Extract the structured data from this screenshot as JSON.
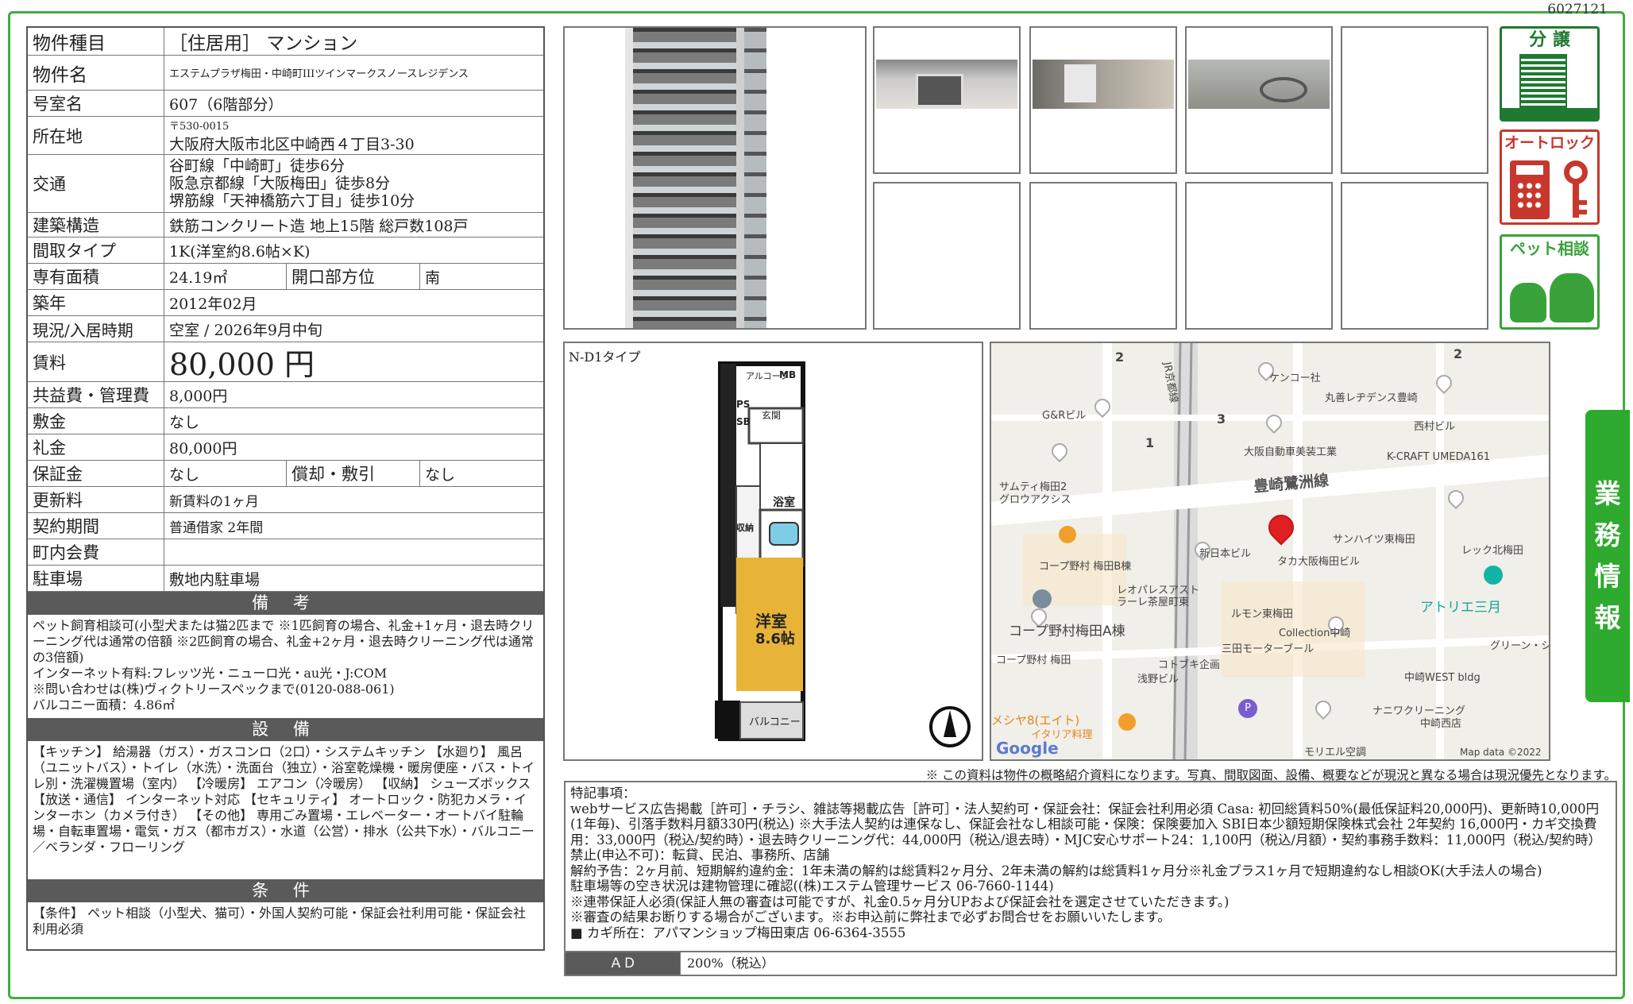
{
  "sheet_id": "6027121",
  "property": {
    "type_label": "物件種目",
    "type_value": "［住居用］ マンション",
    "name_label": "物件名",
    "name_value": "エステムプラザ梅田・中崎町IIIツインマークスノースレジデンス",
    "room_label": "号室名",
    "room_value": "607（6階部分）",
    "address_label": "所在地",
    "postal": "〒530-0015",
    "address": "大阪府大阪市北区中崎西４丁目3-30",
    "transport_label": "交通",
    "transport": [
      "谷町線「中崎町」徒歩6分",
      "阪急京都線「大阪梅田」徒歩8分",
      "堺筋線「天神橋筋六丁目」徒歩10分"
    ],
    "structure_label": "建築構造",
    "structure_value": "鉄筋コンクリート造 地上15階 総戸数108戸",
    "layout_label": "間取タイプ",
    "layout_value": "1K(洋室約8.6帖×K)",
    "area_label": "専有面積",
    "area_value": "24.19㎡",
    "direction_label": "開口部方位",
    "direction_value": "南",
    "built_label": "築年",
    "built_value": "2012年02月",
    "status_label": "現況/入居時期",
    "status_value": "空室 / 2026年9月中旬",
    "rent_label": "賃料",
    "rent_value": "80,000 円",
    "fee_label": "共益費・管理費",
    "fee_value": "8,000円",
    "deposit_label": "敷金",
    "deposit_value": "なし",
    "key_money_label": "礼金",
    "key_money_value": "80,000円",
    "guarantee_label": "保証金",
    "guarantee_value": "なし",
    "amort_label": "償却・敷引",
    "amort_value": "なし",
    "renewal_label": "更新料",
    "renewal_value": "新賃料の1ヶ月",
    "term_label": "契約期間",
    "term_value": "普通借家 2年間",
    "town_label": "町内会費",
    "town_value": "",
    "parking_label": "駐車場",
    "parking_value": "敷地内駐車場"
  },
  "remarks": {
    "title": "備 考",
    "lines": [
      "ペット飼育相談可(小型犬または猫2匹まで ※1匹飼育の場合、礼金+1ヶ月・退去時クリーニング代は通常の倍額 ※2匹飼育の場合、礼金+2ヶ月・退去時クリーニング代は通常の3倍額)",
      "インターネット有料:フレッツ光・ニューロ光・au光・J:COM",
      "※問い合わせは(株)ヴィクトリースペックまで(0120-088-061)",
      "バルコニー面積：4.86㎡"
    ]
  },
  "equipment": {
    "title": "設 備",
    "text": "【キッチン】 給湯器（ガス）・ガスコンロ（2口）・システムキッチン 【水廻り】 風呂（ユニットバス）・トイレ（水洗）・洗面台（独立）・浴室乾燥機・暖房便座・バス・トイレ別・洗濯機置場（室内） 【冷暖房】 エアコン（冷暖房） 【収納】 シューズボックス 【放送・通信】 インターネット対応 【セキュリティ】 オートロック・防犯カメラ・インターホン（カメラ付き） 【その他】 専用ごみ置場・エレベーター・オートバイ駐輪場・自転車置場・電気・ガス（都市ガス）・水道（公営）・排水（公共下水）・バルコニー／ベランダ・フローリング"
  },
  "conditions": {
    "title": "条 件",
    "text": "【条件】 ペット相談（小型犬、猫可）・外国人契約可能・保証会社利用可能・保証会社利用必須"
  },
  "floorplan": {
    "type_label": "N-D1タイプ",
    "rooms": {
      "alcove": "アルコーブ",
      "mb": "MB",
      "ps": "PS",
      "sb": "SB",
      "entrance": "玄関",
      "bath": "浴室",
      "storage": "収納",
      "western_room": "洋室",
      "western_size": "8.6帖",
      "balcony": "バルコニー"
    }
  },
  "badges": {
    "sale": "分 譲",
    "autolock": "オートロック",
    "pet": "ペット相談"
  },
  "map": {
    "labels": [
      "ケンコー社",
      "丸善レヂデンス豊崎",
      "G&Rビル",
      "西村ビル",
      "大阪自動車美装工業",
      "K-CRAFT UMEDA161",
      "サムティ梅田2",
      "グロウアクシス",
      "豊崎鷺洲線",
      "サンハイツ東梅田",
      "新日本ビル",
      "タカ大阪梅田ビル",
      "レック北梅田",
      "コープ野村 梅田B棟",
      "レオパレスアスト",
      "ラーレ茶屋町東",
      "ルモン東梅田",
      "アトリエ三月",
      "コープ野村梅田A棟",
      "Collection中崎",
      "三田モーターブール",
      "グリーン・シ",
      "コープ野村 梅田",
      "コトブキ企画",
      "浅野ビル",
      "中崎WEST bldg",
      "ナニワクリーニング",
      "中崎西店",
      "メシヤ8(エイト)",
      "イタリア料理",
      "モリエル空調",
      "JR京都線"
    ],
    "numbers": [
      "2",
      "2",
      "1",
      "3"
    ],
    "google": "Google",
    "attribution": "Map data ©2022"
  },
  "note": "※ この資料は物件の概略紹介資料になります。写真、間取図面、設備、概要などが現況と異なる場合は現況優先となります。",
  "special": {
    "lines": [
      "特記事項：",
      "webサービス広告掲載［許可］・チラシ、雑誌等掲載広告［許可］・法人契約可・保証会社：保証会社利用必須 Casa: 初回総賃料50%(最低保証料20,000円)、更新時10,000円(1年毎)、引落手数料月額330円(税込) ※大手法人契約は連保なし、保証会社なし相談可能・保険：保険要加入 SBI日本少額短期保険株式会社 2年契約 16,000円・カギ交換費用：33,000円（税込/契約時）・退去時クリーニング代：44,000円（税込/退去時）・MJC安心サポート24：1,100円（税込/月額）・契約事務手数料：11,000円（税込/契約時）",
      "禁止(申込不可)：転貸、民泊、事務所、店舗",
      "解約予告：2ヶ月前、短期解約違約金：1年未満の解約は総賃料2ヶ月分、2年未満の解約は総賃料1ヶ月分※礼金プラス1ヶ月で短期違約なし相談OK(大手法人の場合)",
      "駐車場等の空き状況は建物管理に確認((株)エステム管理サービス 06-7660-1144)",
      "※連帯保証人必須(保証人無の審査は可能ですが、礼金0.5ヶ月分UPおよび保証会社を選定させていただきます。)",
      "※審査の結果お断りする場合がございます。※お申込前に弊社まで必ずお問合せをお願いいたします。",
      "■ カギ所在：アパマンショップ梅田東店 06-6364-3555"
    ],
    "ad_label": "ＡＤ",
    "ad_value": "200%（税込）"
  },
  "side_tab": [
    "業",
    "務",
    "情",
    "報"
  ],
  "colors": {
    "frame": "#3fae3f",
    "sale_badge": "#1e7a30",
    "autolock_badge": "#c8372d",
    "pet_badge": "#3aa23a",
    "map_pin": "#e02020"
  }
}
